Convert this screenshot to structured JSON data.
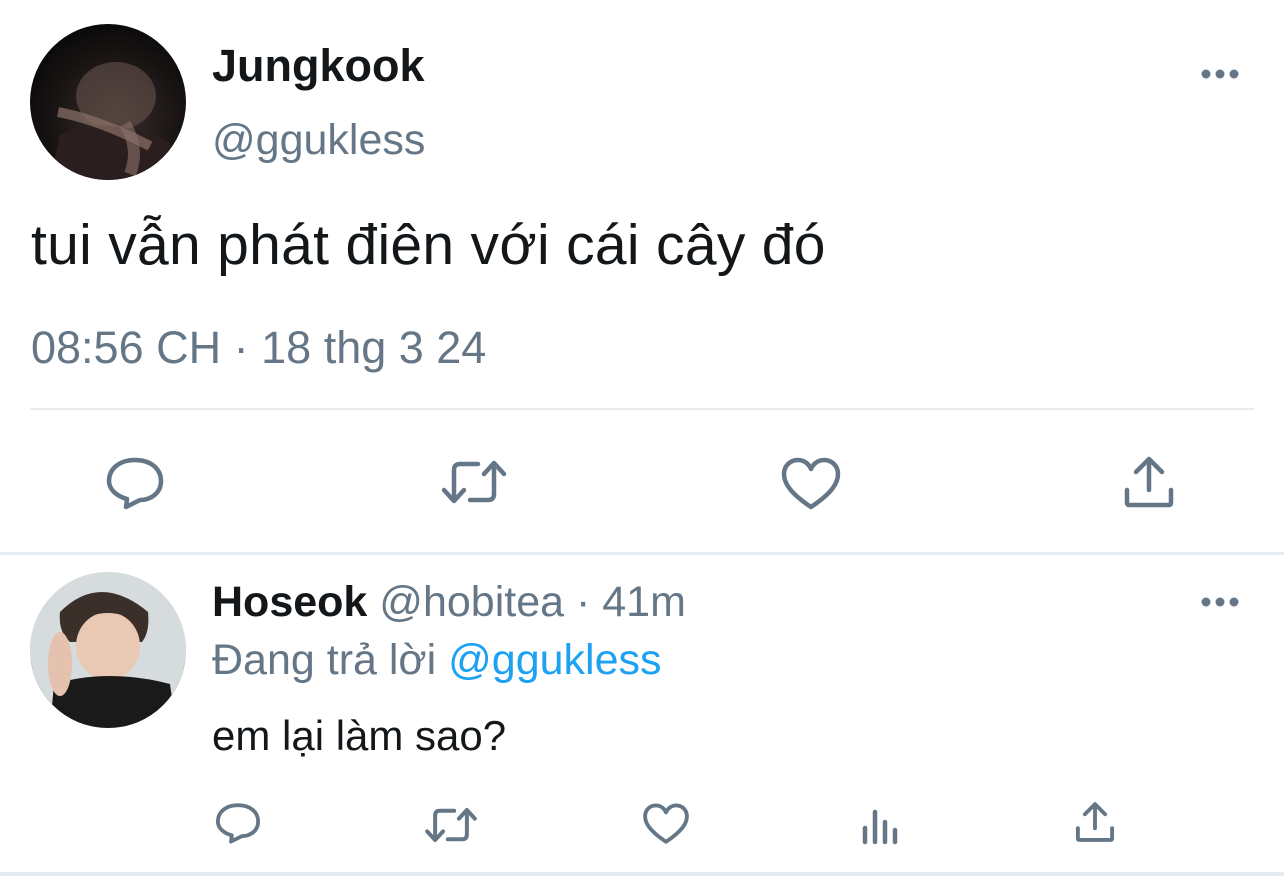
{
  "main_tweet": {
    "author_name": "Jungkook",
    "author_handle": "@ggukless",
    "text": "tui vẫn phát điên với cái cây đó",
    "time": "08:56 CH",
    "separator": "·",
    "date": "18 thg 3 24",
    "avatar": "profile-photo",
    "more_icon": "more-horizontal-icon",
    "actions": [
      {
        "name": "reply",
        "icon": "reply-icon"
      },
      {
        "name": "retweet",
        "icon": "retweet-icon"
      },
      {
        "name": "like",
        "icon": "heart-icon"
      },
      {
        "name": "share",
        "icon": "share-icon"
      }
    ]
  },
  "reply_tweet": {
    "author_name": "Hoseok",
    "author_handle": "@hobitea",
    "separator": "·",
    "time_ago": "41m",
    "replying_label": "Đang trả lời",
    "replying_to": "@ggukless",
    "text": "em lại làm sao?",
    "avatar": "profile-photo",
    "more_icon": "more-horizontal-icon",
    "actions": [
      {
        "name": "reply",
        "icon": "reply-icon"
      },
      {
        "name": "retweet",
        "icon": "retweet-icon"
      },
      {
        "name": "like",
        "icon": "heart-icon"
      },
      {
        "name": "analytics",
        "icon": "bar-chart-icon"
      },
      {
        "name": "share",
        "icon": "share-icon"
      }
    ]
  },
  "colors": {
    "text_primary": "#14171a",
    "text_secondary": "#657786",
    "link": "#1da1f2",
    "divider": "#e6ecf0",
    "background": "#ffffff"
  }
}
